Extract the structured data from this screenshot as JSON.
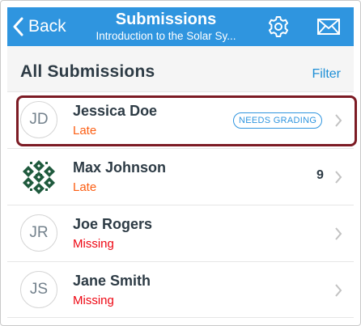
{
  "nav": {
    "back_label": "Back",
    "title": "Submissions",
    "subtitle": "Introduction to the Solar Sy...",
    "gear_icon": "gear-icon",
    "mail_icon": "mail-icon"
  },
  "section": {
    "title": "All Submissions",
    "filter_label": "Filter"
  },
  "submissions": [
    {
      "initials": "JD",
      "name": "Jessica Doe",
      "status": "Late",
      "badge": "NEEDS GRADING",
      "grade": ""
    },
    {
      "initials": "",
      "name": "Max Johnson",
      "status": "Late",
      "badge": "",
      "grade": "9"
    },
    {
      "initials": "JR",
      "name": "Joe Rogers",
      "status": "Missing",
      "badge": "",
      "grade": ""
    },
    {
      "initials": "JS",
      "name": "Jane Smith",
      "status": "Missing",
      "badge": "",
      "grade": ""
    }
  ],
  "colors": {
    "nav_background": "#2f95df",
    "late": "#fc5e13",
    "missing": "#ee0612",
    "highlight": "#7c1b24",
    "link": "#1e8fd6"
  }
}
